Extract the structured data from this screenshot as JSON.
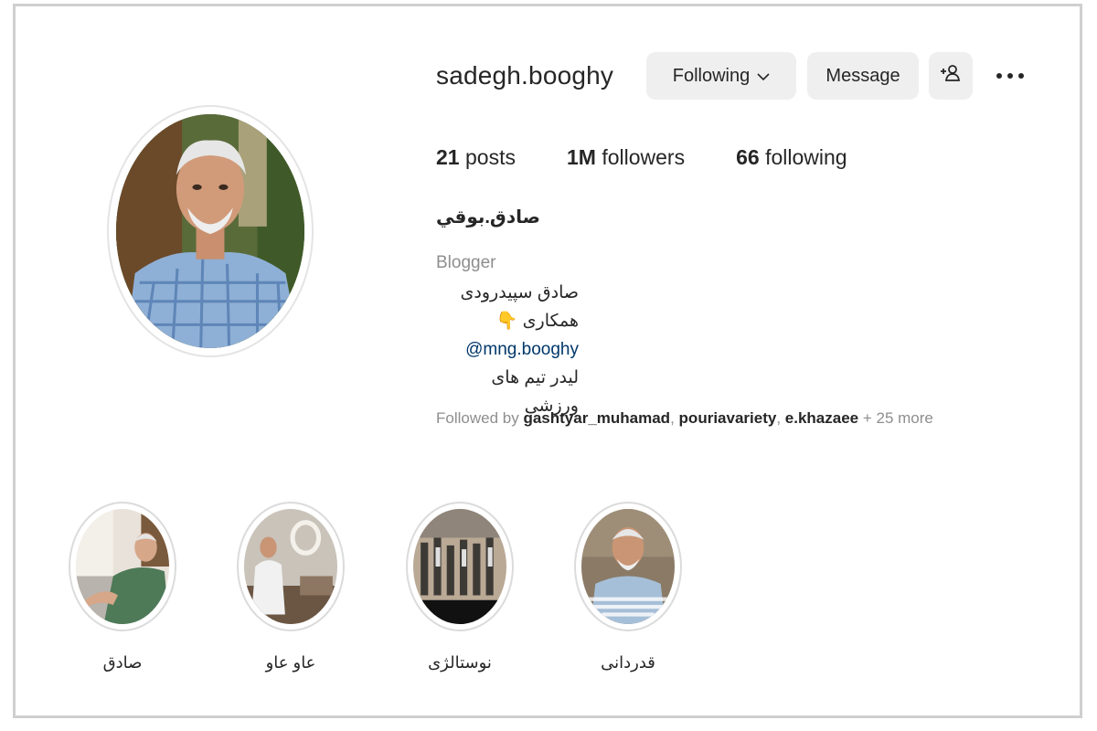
{
  "profile": {
    "username": "sadegh.booghy",
    "full_name": "صادق.بوقي",
    "category": "Blogger",
    "bio_lines": [
      "صادق سپیدرودی",
      "همکاری 👇",
      "@mng.booghy",
      "لیدر تیم های ورزشی"
    ]
  },
  "buttons": {
    "following": "Following",
    "message": "Message",
    "suggest_icon": "person-plus-icon",
    "more_icon": "more-dots-icon"
  },
  "stats": {
    "posts_count": "21",
    "posts_label": "posts",
    "followers_count": "1M",
    "followers_label": "followers",
    "following_count": "66",
    "following_label": "following"
  },
  "followed_by": {
    "prefix": "Followed by",
    "users": [
      "gashtyar_muhamad",
      "pouriavariety",
      "e.khazaee"
    ],
    "sep": ",",
    "more": "+ 25 more"
  },
  "highlights": [
    {
      "label": "صادق"
    },
    {
      "label": "عاو عاو"
    },
    {
      "label": "نوستالژی"
    },
    {
      "label": "قدردانی"
    }
  ],
  "colors": {
    "button_bg": "#efefef",
    "secondary_text": "#8e8e8e",
    "link": "#00376b"
  }
}
